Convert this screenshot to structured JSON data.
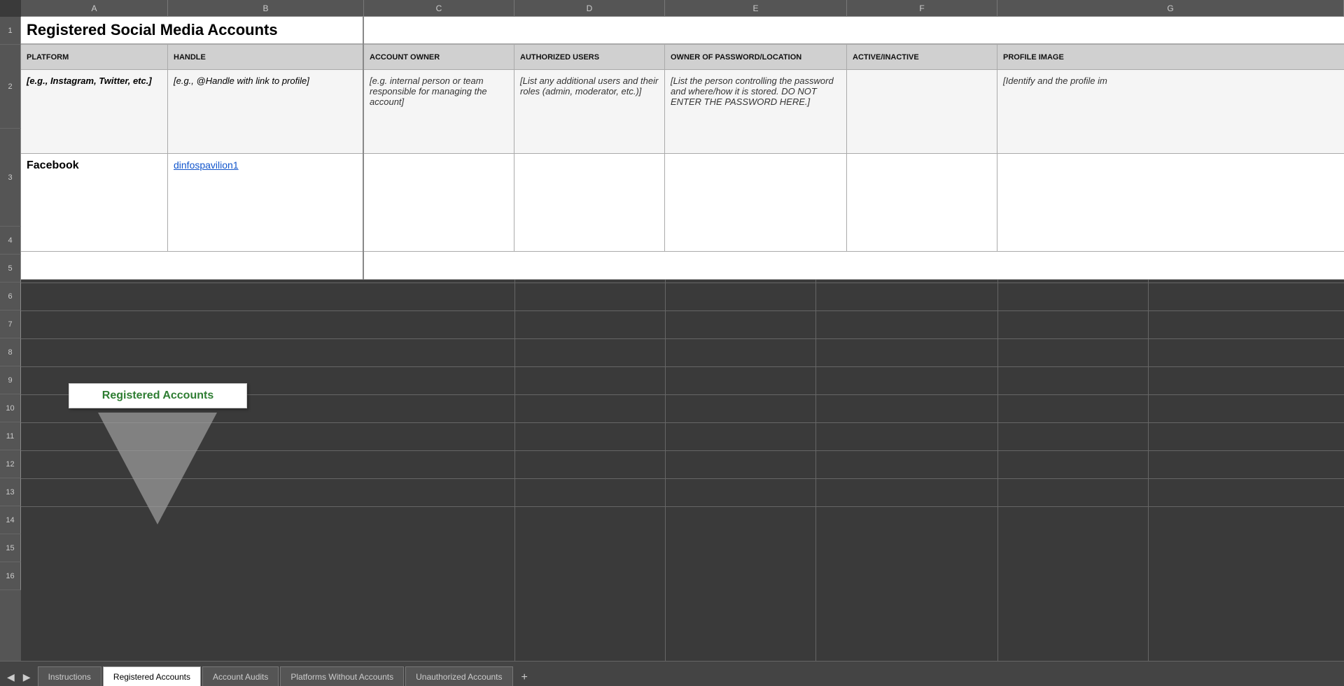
{
  "spreadsheet": {
    "title": "Registered Social Media Accounts",
    "columns": {
      "letters": [
        "A",
        "B",
        "C",
        "D",
        "E",
        "F",
        "G"
      ],
      "widths": [
        210,
        280,
        215,
        215,
        260,
        215,
        200
      ],
      "headers": [
        "PLATFORM",
        "HANDLE",
        "ACCOUNT OWNER",
        "AUTHORIZED USERS",
        "OWNER OF PASSWORD/LOCATION",
        "ACTIVE/INACTIVE",
        "PROFILE IMAGE"
      ]
    },
    "rows": {
      "row1_label": "1",
      "row2_label": "2",
      "row3_label": "3",
      "row4_label": "4",
      "row5_label": "5",
      "row6_label": "6",
      "row7_label": "7",
      "row8_label": "8",
      "row9_label": "9",
      "row10_label": "10",
      "row11_label": "11",
      "row12_label": "12",
      "row13_label": "13",
      "row14_label": "14",
      "row15_label": "15",
      "row16_label": "16"
    },
    "data": {
      "placeholder_col_a": "[e.g., Instagram, Twitter, etc.]",
      "placeholder_col_b": "[e.g., @Handle with link to profile]",
      "placeholder_col_c": "[e.g. internal person or team responsible for managing the account]",
      "placeholder_col_d": "[List any additional users and their roles (admin, moderator, etc.)]",
      "placeholder_col_e": "[List the person controlling the password and where/how it is stored. DO NOT ENTER THE PASSWORD HERE.]",
      "placeholder_col_f": "",
      "placeholder_col_g": "[Identify and the profile im",
      "facebook_platform": "Facebook",
      "facebook_handle": "dinfospavilion1",
      "facebook_handle_href": "#"
    }
  },
  "tooltip": {
    "text": "Registered Accounts"
  },
  "sheet_tabs": [
    {
      "label": "Instructions",
      "active": false
    },
    {
      "label": "Registered Accounts",
      "active": true
    },
    {
      "label": "Account Audits",
      "active": false
    },
    {
      "label": "Platforms Without Accounts",
      "active": false
    },
    {
      "label": "Unauthorized Accounts",
      "active": false
    }
  ],
  "sheet_add_button": "+",
  "colors": {
    "active_tab_bg": "#ffffff",
    "inactive_tab_bg": "#555555",
    "tooltip_text": "#2e7d32",
    "header_bg": "#cccccc",
    "link_color": "#1155CC"
  }
}
